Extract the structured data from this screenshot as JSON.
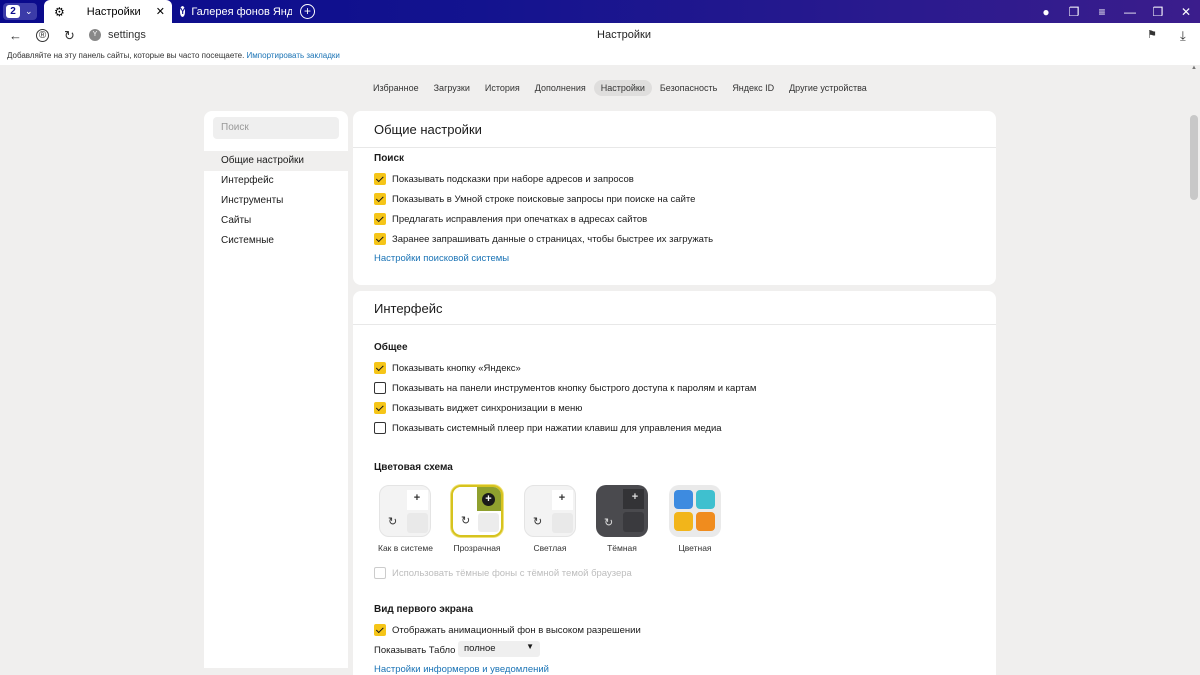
{
  "tabs": {
    "count": "2",
    "active_title": "Настройки",
    "inactive_title": "Галерея фонов Яндекс Бр"
  },
  "address": {
    "url": "settings",
    "page_title": "Настройки"
  },
  "bookmarks_bar": {
    "text": "Добавляйте на эту панель сайты, которые вы часто посещаете.",
    "link": "Импортировать закладки"
  },
  "topnav": [
    "Избранное",
    "Загрузки",
    "История",
    "Дополнения",
    "Настройки",
    "Безопасность",
    "Яндекс ID",
    "Другие устройства"
  ],
  "sidebar": {
    "search_placeholder": "Поиск",
    "items": [
      "Общие настройки",
      "Интерфейс",
      "Инструменты",
      "Сайты",
      "Системные"
    ]
  },
  "general": {
    "title": "Общие настройки",
    "search_section": "Поиск",
    "options": [
      {
        "label": "Показывать подсказки при наборе адресов и запросов",
        "checked": true
      },
      {
        "label": "Показывать в Умной строке поисковые запросы при поиске на сайте",
        "checked": true
      },
      {
        "label": "Предлагать исправления при опечатках в адресах сайтов",
        "checked": true
      },
      {
        "label": "Заранее запрашивать данные о страницах, чтобы быстрее их загружать",
        "checked": true
      }
    ],
    "link": "Настройки поисковой системы"
  },
  "interface": {
    "title": "Интерфейс",
    "general_section": "Общее",
    "options": [
      {
        "label": "Показывать кнопку «Яндекс»",
        "checked": true
      },
      {
        "label": "Показывать на панели инструментов кнопку быстрого доступа к паролям и картам",
        "checked": false
      },
      {
        "label": "Показывать виджет синхронизации в меню",
        "checked": true
      },
      {
        "label": "Показывать системный плеер при нажатии клавиш для управления медиа",
        "checked": false
      }
    ],
    "color_section": "Цветовая схема",
    "themes": [
      "Как в системе",
      "Прозрачная",
      "Светлая",
      "Тёмная",
      "Цветная"
    ],
    "selected_theme": "Прозрачная",
    "dark_bg_option": "Использовать тёмные фоны с тёмной темой браузера",
    "first_screen_section": "Вид первого экрана",
    "animated_bg_option": "Отображать анимационный фон в высоком разрешении",
    "tablo_label": "Показывать Табло",
    "tablo_value": "полное",
    "informers_link": "Настройки информеров и уведомлений"
  },
  "colors": {
    "titlebar": "#0a0a8c",
    "accent_yellow": "#f5c518",
    "link": "#1a73b5"
  }
}
